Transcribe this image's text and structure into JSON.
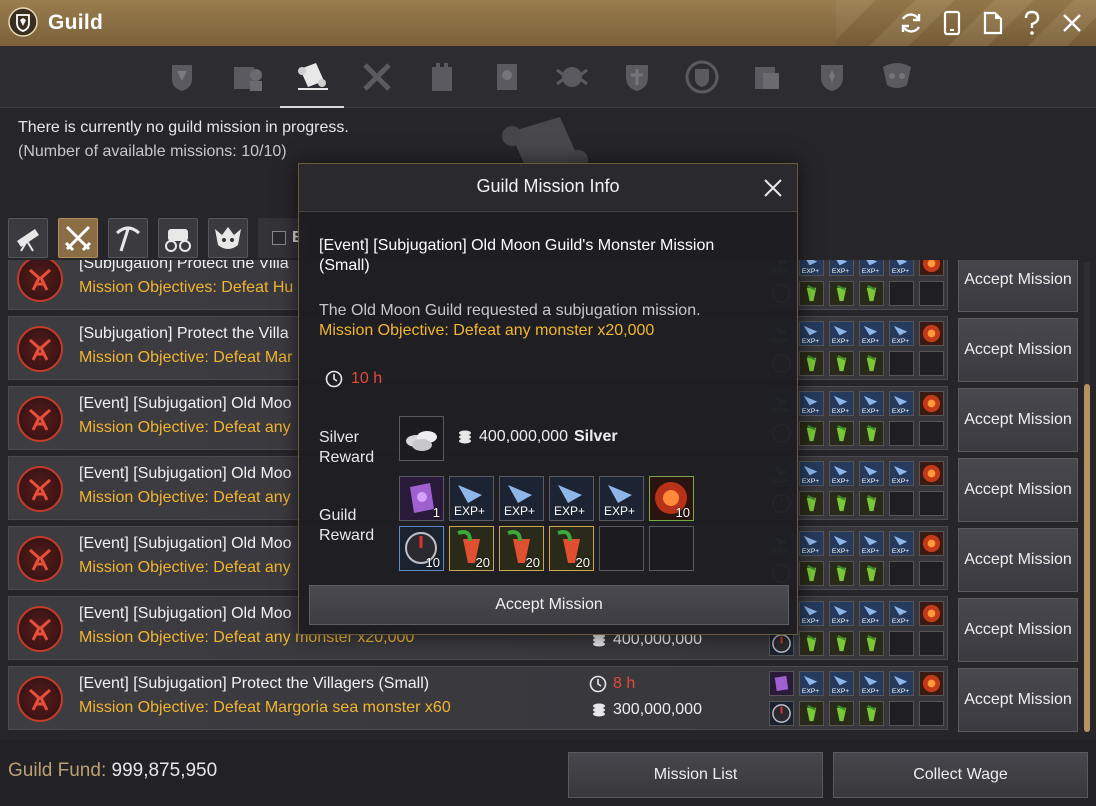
{
  "window": {
    "title": "Guild"
  },
  "title_bar_icons": [
    "refresh-icon",
    "mobile-icon",
    "document-icon",
    "help-icon",
    "close-icon"
  ],
  "tabs": [
    "guild-crest-icon",
    "members-icon",
    "missions-scroll-icon",
    "war-icon",
    "fortress-icon",
    "notice-icon",
    "alliance-icon",
    "shield-icon",
    "emblem-icon",
    "records-icon",
    "badge-icon",
    "crossed-swords-icon"
  ],
  "active_tab": 2,
  "status": {
    "line1": "There is currently no guild mission in progress.",
    "line2": "(Number of available missions: 10/10)"
  },
  "categories": [
    "gathering-icon",
    "subjugation-icon",
    "pickaxe-icon",
    "trade-icon",
    "boss-icon"
  ],
  "active_category": 1,
  "filter": {
    "label": "E"
  },
  "rows": [
    {
      "title": "[Subjugation] Protect the Villa",
      "obj": "Mission Objectives: Defeat Hu",
      "time": "",
      "silver": ""
    },
    {
      "title": "[Subjugation] Protect the Villa",
      "obj": "Mission Objective: Defeat Mar",
      "time": "",
      "silver": ""
    },
    {
      "title": "[Event] [Subjugation] Old Moo",
      "obj": "Mission Objective: Defeat any",
      "time": "",
      "silver": ""
    },
    {
      "title": "[Event] [Subjugation] Old Moo",
      "obj": "Mission Objective: Defeat any",
      "time": "",
      "silver": ""
    },
    {
      "title": "[Event] [Subjugation] Old Moo",
      "obj": "Mission Objective: Defeat any",
      "time": "",
      "silver": ""
    },
    {
      "title": "[Event] [Subjugation] Old Moo",
      "obj": "Mission Objective: Defeat any monster x20,000",
      "time": "",
      "silver": "400,000,000"
    },
    {
      "title": "[Event] [Subjugation] Protect the Villagers (Small)",
      "obj": "Mission Objective: Defeat Margoria sea monster x60",
      "time": "8 h",
      "silver": "300,000,000"
    }
  ],
  "accept_label": "Accept Mission",
  "footer": {
    "fund_label": "Guild Fund:",
    "fund_value": "999,875,950",
    "mission_list": "Mission List",
    "collect_wage": "Collect Wage"
  },
  "modal": {
    "title": "Guild Mission Info",
    "name": "[Event] [Subjugation] Old Moon Guild's Monster Mission (Small)",
    "desc": "The Old Moon Guild requested a subjugation mission.",
    "objective": "Mission Objective: Defeat any monster x20,000",
    "time": "10 h",
    "silver_label": "Silver Reward",
    "silver_value": "400,000,000",
    "silver_unit": "Silver",
    "guild_label": "Guild Reward",
    "guild_rewards_row1": [
      {
        "icon": "scroll-icon",
        "qty": "1"
      },
      {
        "icon": "exp-icon",
        "qty": ""
      },
      {
        "icon": "exp-icon",
        "qty": ""
      },
      {
        "icon": "exp-icon",
        "qty": ""
      },
      {
        "icon": "exp-icon",
        "qty": ""
      },
      {
        "icon": "fire-orb-icon",
        "qty": "10"
      }
    ],
    "guild_rewards_row2": [
      {
        "icon": "compass-icon",
        "qty": "10"
      },
      {
        "icon": "drink-icon",
        "qty": "20"
      },
      {
        "icon": "drink-icon",
        "qty": "20"
      },
      {
        "icon": "drink-icon",
        "qty": "20"
      }
    ],
    "accept": "Accept Mission"
  }
}
